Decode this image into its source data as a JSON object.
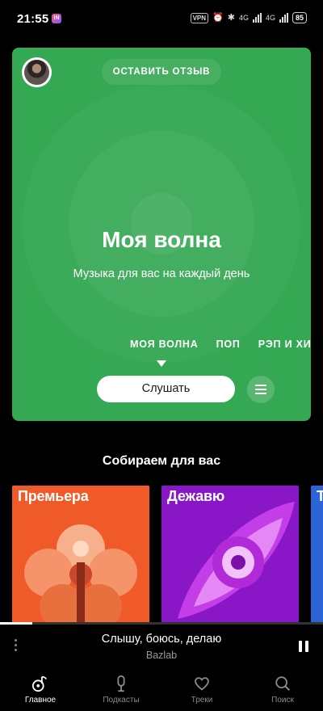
{
  "status_bar": {
    "time": "21:55",
    "app_badge": "IN",
    "vpn": "VPN",
    "network_1": "4G",
    "network_2": "4G",
    "battery": "85"
  },
  "hero": {
    "feedback_button": "ОСТАВИТЬ ОТЗЫВ",
    "title": "Моя волна",
    "subtitle": "Музыка для вас на каждый день",
    "genres": [
      "МОЯ ВОЛНА",
      "ПОП",
      "РЭП И ХИП-"
    ],
    "listen_button": "Слушать",
    "bg_color": "#35a853"
  },
  "section": {
    "title": "Собираем для вас",
    "tiles": [
      {
        "label": "Премьера",
        "color": "#f05a28"
      },
      {
        "label": "Дежавю",
        "color": "#9d1fd1"
      },
      {
        "label": "Т",
        "color": "#2a64d6"
      }
    ]
  },
  "player": {
    "track": "Слышу, боюсь, делаю",
    "artist": "Bazlab",
    "progress": 0.1
  },
  "nav": {
    "items": [
      {
        "label": "Главное",
        "icon": "music-note-icon",
        "active": true
      },
      {
        "label": "Подкасты",
        "icon": "microphone-icon",
        "active": false
      },
      {
        "label": "Треки",
        "icon": "heart-icon",
        "active": false
      },
      {
        "label": "Поиск",
        "icon": "search-icon",
        "active": false
      }
    ]
  }
}
